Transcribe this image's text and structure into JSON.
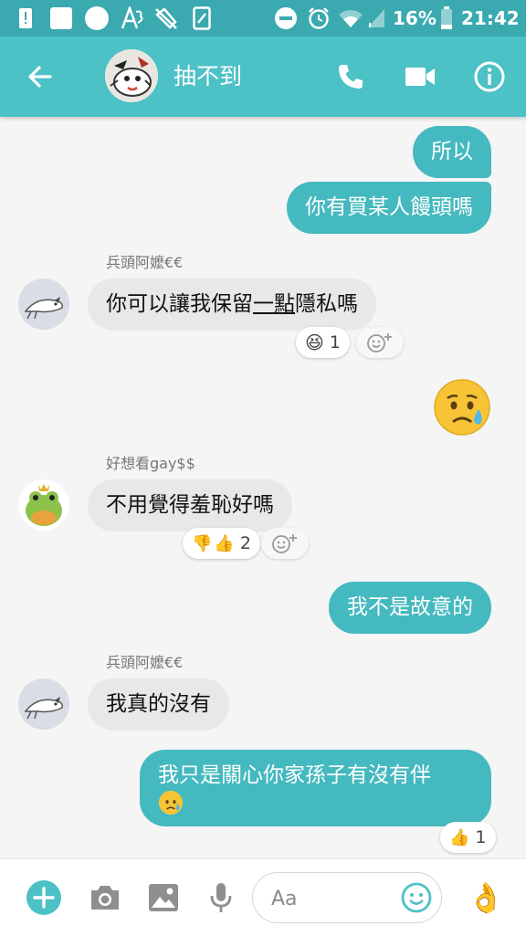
{
  "status_bar": {
    "battery_percent": "16%",
    "time": "21:42",
    "left_icons": [
      "alert-icon",
      "square-icon",
      "circle-icon",
      "a3-icon",
      "mute-icon",
      "card-icon"
    ],
    "right_icons": [
      "dnd-icon",
      "alarm-icon",
      "wifi-icon",
      "signal-icon",
      "battery-icon"
    ]
  },
  "header": {
    "title": "抽不到",
    "back_icon": "arrow-left-icon",
    "call_icon": "phone-icon",
    "video_icon": "video-icon",
    "info_icon": "info-icon"
  },
  "messages": {
    "m1": {
      "text": "所以"
    },
    "m2": {
      "text": "你有買某人饅頭嗎"
    },
    "m3": {
      "sender": "兵頭阿嬤€€",
      "text_a": "你可以讓我保留",
      "text_u": "一點",
      "text_b": "隱私嗎",
      "reaction_count": "1"
    },
    "m4": {
      "emoji": "😥"
    },
    "m5": {
      "sender": "好想看gay$$",
      "text": "不用覺得羞恥好嗎",
      "reaction_count": "2"
    },
    "m6": {
      "text": "我不是故意的"
    },
    "m7": {
      "sender": "兵頭阿嬤€€",
      "text": "我真的沒有"
    },
    "m8": {
      "text_line1": "我只是關心你家孫子有沒有伴",
      "emoji": "😥",
      "reaction_count": "1"
    }
  },
  "composer": {
    "placeholder": "Aa",
    "icons": [
      "plus-icon",
      "camera-icon",
      "image-icon",
      "mic-icon",
      "emoji-icon",
      "ok-hand-icon"
    ]
  },
  "colors": {
    "accent": "#4cc1c6",
    "status_bar": "#3aa9b0",
    "outgoing_bubble": "#44b9bf",
    "incoming_bubble": "#e8e8e8"
  }
}
